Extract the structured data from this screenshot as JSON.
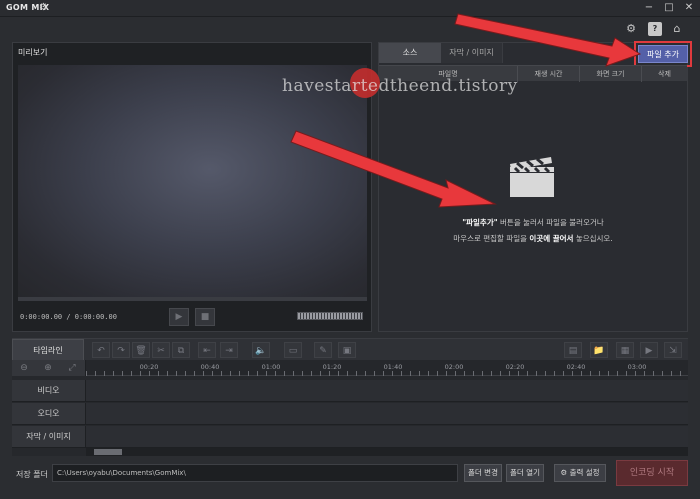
{
  "app": {
    "title": "GOM MIX",
    "window_controls": [
      "−",
      "□",
      "✕"
    ]
  },
  "top_icons": [
    "gear-icon",
    "help-icon",
    "home-icon"
  ],
  "preview": {
    "title": "미리보기",
    "time": "0:00:00.00 / 0:00:00.00"
  },
  "source": {
    "tabs": [
      "소스",
      "자막 / 이미지"
    ],
    "add_file_label": "파일 추가",
    "columns": [
      "파일명",
      "재생 시간",
      "화면 크기",
      "삭제"
    ],
    "empty_line1_quote": "\"파일추가\"",
    "empty_line1_rest": " 버튼을 눌러서 파일을 불러오거나",
    "empty_line2_pre": "마우스로 편집할 파일을 ",
    "empty_line2_bold": "이곳에 끌어서",
    "empty_line2_post": " 놓으십시오."
  },
  "timeline": {
    "label": "타임라인",
    "ruler_ticks": [
      "00:20",
      "00:40",
      "01:00",
      "01:20",
      "01:40",
      "02:00",
      "02:20",
      "02:40",
      "03:00"
    ],
    "tracks": [
      "비디오",
      "오디오",
      "자막 / 이미지"
    ]
  },
  "footer": {
    "save_label": "저장 폴더",
    "save_path": "C:\\Users\\oyabu\\Documents\\GomMix\\",
    "change_folder": "폴더 변경",
    "open_folder": "폴더 열기",
    "output_settings": "출력 설정",
    "encode": "인코딩 시작"
  },
  "watermark": "havestartedtheend.tistory",
  "colors": {
    "accent": "#5460a8",
    "highlight": "#e03a3e",
    "encode": "#5a2a2e"
  }
}
